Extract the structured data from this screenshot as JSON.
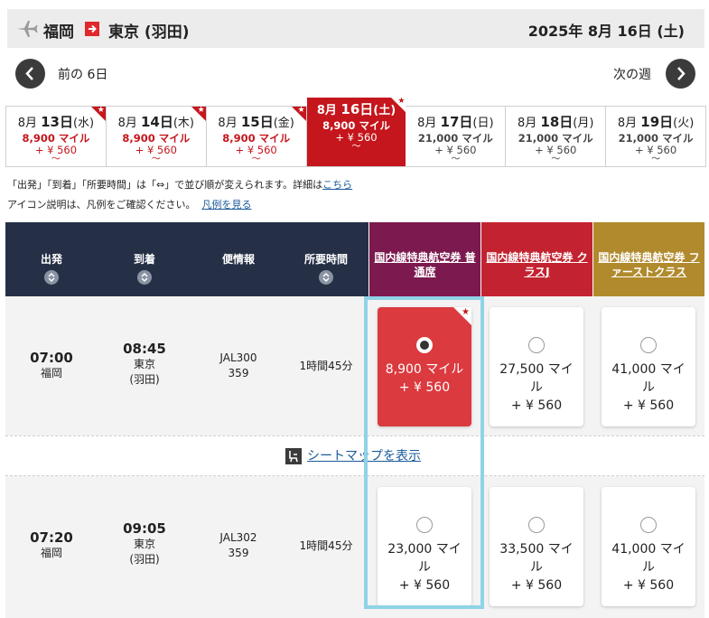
{
  "header": {
    "from": "福岡",
    "to": "東京 (羽田)",
    "date": "2025年 8月 16日 (土)"
  },
  "nav": {
    "prev_label": "前の 6日",
    "next_label": "次の週"
  },
  "dates": [
    {
      "day": "8月 ",
      "num": "13日",
      "dow": "(水)",
      "miles": "8,900 マイル",
      "tax": "+ ¥ 560",
      "rest": "～",
      "star": true,
      "style": "red"
    },
    {
      "day": "8月 ",
      "num": "14日",
      "dow": "(木)",
      "miles": "8,900 マイル",
      "tax": "+ ¥ 560",
      "rest": "～",
      "star": true,
      "style": "red"
    },
    {
      "day": "8月 ",
      "num": "15日",
      "dow": "(金)",
      "miles": "8,900 マイル",
      "tax": "+ ¥ 560",
      "rest": "～",
      "star": true,
      "style": "red"
    },
    {
      "day": "8月 ",
      "num": "16日",
      "dow": "(土)",
      "miles": "8,900 マイル",
      "tax": "+ ¥ 560",
      "rest": "～",
      "star": true,
      "style": "sel"
    },
    {
      "day": "8月 ",
      "num": "17日",
      "dow": "(日)",
      "miles": "21,000 マイル",
      "tax": "+ ¥ 560",
      "rest": "～",
      "star": false,
      "style": "gray"
    },
    {
      "day": "8月 ",
      "num": "18日",
      "dow": "(月)",
      "miles": "21,000 マイル",
      "tax": "+ ¥ 560",
      "rest": "～",
      "star": false,
      "style": "gray"
    },
    {
      "day": "8月 ",
      "num": "19日",
      "dow": "(火)",
      "miles": "21,000 マイル",
      "tax": "+ ¥ 560",
      "rest": "～",
      "star": false,
      "style": "gray"
    }
  ],
  "notes": {
    "sort_note": "「出発」「到着」「所要時間」は「⇔」で並び順が変えられます。詳細は",
    "sort_link": "こちら",
    "legend_note": "アイコン説明は、凡例をご確認ください。",
    "legend_link": "凡例を見る"
  },
  "table_header": {
    "depart": "出発",
    "arrive": "到着",
    "flight": "便情報",
    "duration": "所要時間",
    "fare1": "国内線特典航空券 普通席",
    "fare2": "国内線特典航空券 クラスJ",
    "fare3": "国内線特典航空券 ファーストクラス"
  },
  "flights": [
    {
      "dep_time": "07:00",
      "dep_place": "福岡",
      "arr_time": "08:45",
      "arr_place1": "東京",
      "arr_place2": "(羽田)",
      "flight": "JAL300",
      "aircraft": "359",
      "duration": "1時間45分",
      "fares": [
        {
          "miles": "8,900 マイル",
          "tax": "+ ¥ 560",
          "selected": true,
          "star": true
        },
        {
          "miles": "27,500 マイル",
          "tax": "+ ¥ 560",
          "selected": false,
          "star": false
        },
        {
          "miles": "41,000 マイル",
          "tax": "+ ¥ 560",
          "selected": false,
          "star": false
        }
      ]
    },
    {
      "dep_time": "07:20",
      "dep_place": "福岡",
      "arr_time": "09:05",
      "arr_place1": "東京",
      "arr_place2": "(羽田)",
      "flight": "JAL302",
      "aircraft": "359",
      "duration": "1時間45分",
      "fares": [
        {
          "miles": "23,000 マイル",
          "tax": "+ ¥ 560",
          "selected": false,
          "star": false
        },
        {
          "miles": "33,500 マイル",
          "tax": "+ ¥ 560",
          "selected": false,
          "star": false
        },
        {
          "miles": "41,000 マイル",
          "tax": "+ ¥ 560",
          "selected": false,
          "star": false
        }
      ]
    }
  ],
  "seatmap_label": "シートマップを表示",
  "colors": {
    "fare1_header": "#7c1a4f",
    "fare2_header": "#c32330",
    "fare3_header": "#b08a2c",
    "table_header": "#253047",
    "accent_red": "#c4161c",
    "highlight": "#8fd3e6"
  }
}
